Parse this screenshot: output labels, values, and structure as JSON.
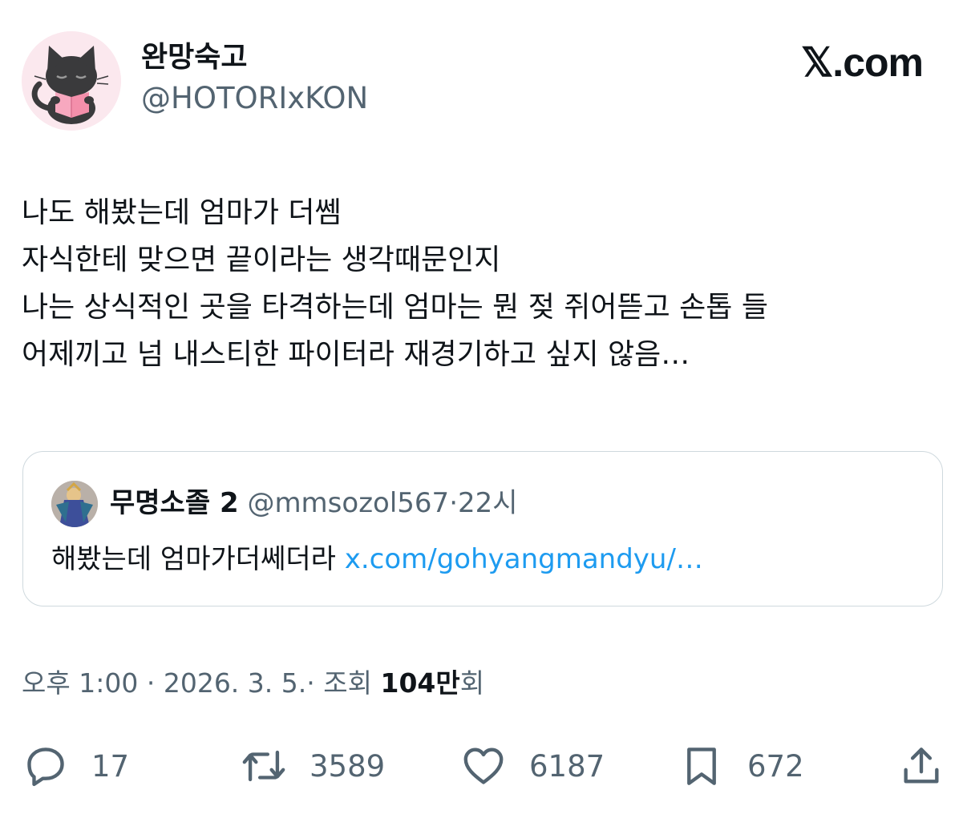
{
  "author": {
    "display_name": "완망숙고",
    "handle": "@HOTORIxKON",
    "avatar_icon": "black-cat-reading-book-avatar"
  },
  "brand": {
    "label": "𝕏.com"
  },
  "tweet": {
    "lines": [
      "나도 해봤는데 엄마가 더쎔",
      "자식한테 맞으면 끝이라는 생각때문인지",
      "나는 상식적인 곳을 타격하는데 엄마는 뭔 젖 쥐어뜯고 손톱 들",
      "어제끼고 넘 내스티한 파이터라 재경기하고 싶지 않음…"
    ]
  },
  "quote": {
    "name": "무명소졸 2",
    "handle": "@mmsozol567",
    "separator": "·",
    "time": "22시",
    "text": "해봤는데 엄마가더쎄더라",
    "link": "x.com/gohyangmandyu/…",
    "avatar_icon": "anime-character-avatar"
  },
  "meta": {
    "time": "오후 1:00",
    "separator": "·",
    "date": "2026. 3. 5.",
    "views_prefix": "조회",
    "views_value": "104만",
    "views_suffix": "회"
  },
  "actions": {
    "reply": {
      "icon": "reply-icon",
      "count": "17"
    },
    "retweet": {
      "icon": "retweet-icon",
      "count": "3589"
    },
    "like": {
      "icon": "heart-icon",
      "count": "6187"
    },
    "bookmark": {
      "icon": "bookmark-icon",
      "count": "672"
    },
    "share": {
      "icon": "share-icon"
    }
  },
  "colors": {
    "text": "#0f1419",
    "secondary": "#536471",
    "link": "#1d9bf0",
    "border": "#cfd9de"
  }
}
